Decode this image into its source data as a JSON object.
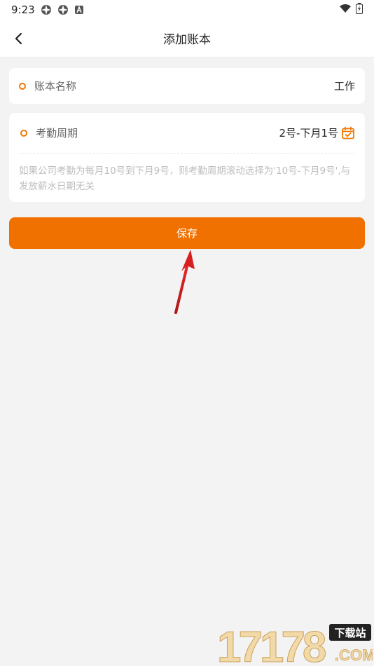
{
  "status_bar": {
    "time": "9:23",
    "icons": [
      "app-icon",
      "app-icon",
      "a-icon"
    ],
    "right_icons": [
      "wifi-icon",
      "battery-icon"
    ]
  },
  "nav": {
    "title": "添加账本",
    "back_icon": "chevron-left-icon"
  },
  "form": {
    "name_label": "账本名称",
    "name_value": "工作",
    "cycle_label": "考勤周期",
    "cycle_value": "2号-下月1号",
    "cycle_icon": "calendar-icon",
    "hint": "如果公司考勤为每月10号到下月9号，则考勤周期滚动选择为'10号-下月9号',与发放薪水日期无关"
  },
  "save_label": "保存",
  "watermark": {
    "number": "17178",
    "tag": "下载站",
    "domain": ".COM"
  },
  "colors": {
    "accent": "#f07000",
    "annotation_arrow": "#d81e1e"
  }
}
